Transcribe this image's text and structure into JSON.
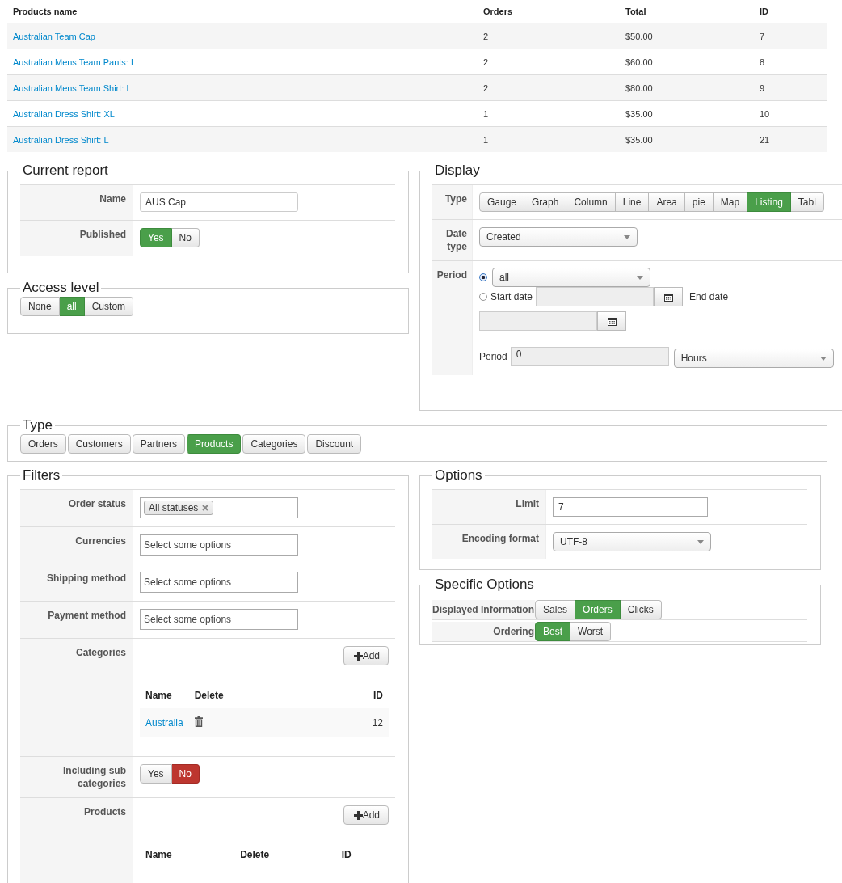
{
  "products_table": {
    "columns": [
      "Products name",
      "Orders",
      "Total",
      "ID"
    ],
    "rows": [
      {
        "name": "Australian Team Cap",
        "orders": "2",
        "total": "$50.00",
        "id": "7"
      },
      {
        "name": "Australian Mens Team Pants: L",
        "orders": "2",
        "total": "$60.00",
        "id": "8"
      },
      {
        "name": "Australian Mens Team Shirt: L",
        "orders": "2",
        "total": "$80.00",
        "id": "9"
      },
      {
        "name": "Australian Dress Shirt: XL",
        "orders": "1",
        "total": "$35.00",
        "id": "10"
      },
      {
        "name": "Australian Dress Shirt: L",
        "orders": "1",
        "total": "$35.00",
        "id": "21"
      }
    ]
  },
  "current_report": {
    "title": "Current report",
    "rows": [
      {
        "label": "Name",
        "kind": "text",
        "value": "AUS Cap"
      },
      {
        "label": "Published",
        "kind": "yesno",
        "options": [
          {
            "label": "Yes",
            "selected": true
          },
          {
            "label": "No",
            "selected": false
          }
        ]
      }
    ]
  },
  "access_level": {
    "title": "Access level",
    "options": [
      {
        "label": "None",
        "selected": false
      },
      {
        "label": "all",
        "selected": true
      },
      {
        "label": "Custom",
        "selected": false
      }
    ]
  },
  "display": {
    "title": "Display",
    "type_label": "Type",
    "types": [
      {
        "label": "Gauge",
        "selected": false
      },
      {
        "label": "Graph",
        "selected": false
      },
      {
        "label": "Column",
        "selected": false
      },
      {
        "label": "Line",
        "selected": false
      },
      {
        "label": "Area",
        "selected": false
      },
      {
        "label": "pie",
        "selected": false
      },
      {
        "label": "Map",
        "selected": false
      },
      {
        "label": "Listing",
        "selected": true
      },
      {
        "label": "Tabl",
        "selected": false
      }
    ],
    "date_type_label": "Date type",
    "date_type": "Created",
    "period_label": "Period",
    "period_options": [
      {
        "kind": "select",
        "value": "all",
        "selected": true
      },
      {
        "kind": "range",
        "label": "Start date",
        "end_label": "End date",
        "selected": false
      }
    ],
    "period_field_label": "Period",
    "period_value": "0",
    "period_unit": "Hours"
  },
  "type": {
    "title": "Type",
    "options": [
      {
        "label": "Orders",
        "selected": false
      },
      {
        "label": "Customers",
        "selected": false
      },
      {
        "label": "Partners",
        "selected": false
      },
      {
        "label": "Products",
        "selected": true
      },
      {
        "label": "Categories",
        "selected": false
      },
      {
        "label": "Discount",
        "selected": false
      }
    ]
  },
  "filters": {
    "title": "Filters",
    "rows": [
      {
        "label": "Order status",
        "kind": "tags",
        "tags": [
          "All statuses"
        ]
      },
      {
        "label": "Currencies",
        "kind": "multiselect",
        "placeholder": "Select some options"
      },
      {
        "label": "Shipping method",
        "kind": "multiselect",
        "placeholder": "Select some options"
      },
      {
        "label": "Payment method",
        "kind": "multiselect",
        "placeholder": "Select some options"
      },
      {
        "label": "Categories",
        "kind": "list",
        "add": "Add",
        "columns": [
          "Name",
          "Delete",
          "ID"
        ],
        "rows": [
          {
            "name": "Australia",
            "id": "12"
          }
        ]
      },
      {
        "label": "Including sub categories",
        "kind": "yesno",
        "options": [
          {
            "label": "Yes",
            "selected": false
          },
          {
            "label": "No",
            "selected": true
          }
        ]
      },
      {
        "label": "Products",
        "kind": "list",
        "add": "Add",
        "columns": [
          "Name",
          "Delete",
          "ID"
        ],
        "rows": []
      }
    ]
  },
  "options": {
    "title": "Options",
    "rows": [
      {
        "label": "Limit",
        "kind": "text",
        "value": "7"
      },
      {
        "label": "Encoding format",
        "kind": "select",
        "value": "UTF-8"
      }
    ]
  },
  "specific_options": {
    "title": "Specific Options",
    "rows": [
      {
        "label": "Displayed Information",
        "options": [
          {
            "label": "Sales",
            "selected": false
          },
          {
            "label": "Orders",
            "selected": true
          },
          {
            "label": "Clicks",
            "selected": false
          }
        ]
      },
      {
        "label": "Ordering",
        "options": [
          {
            "label": "Best",
            "selected": true
          },
          {
            "label": "Worst",
            "selected": false
          }
        ]
      }
    ]
  }
}
